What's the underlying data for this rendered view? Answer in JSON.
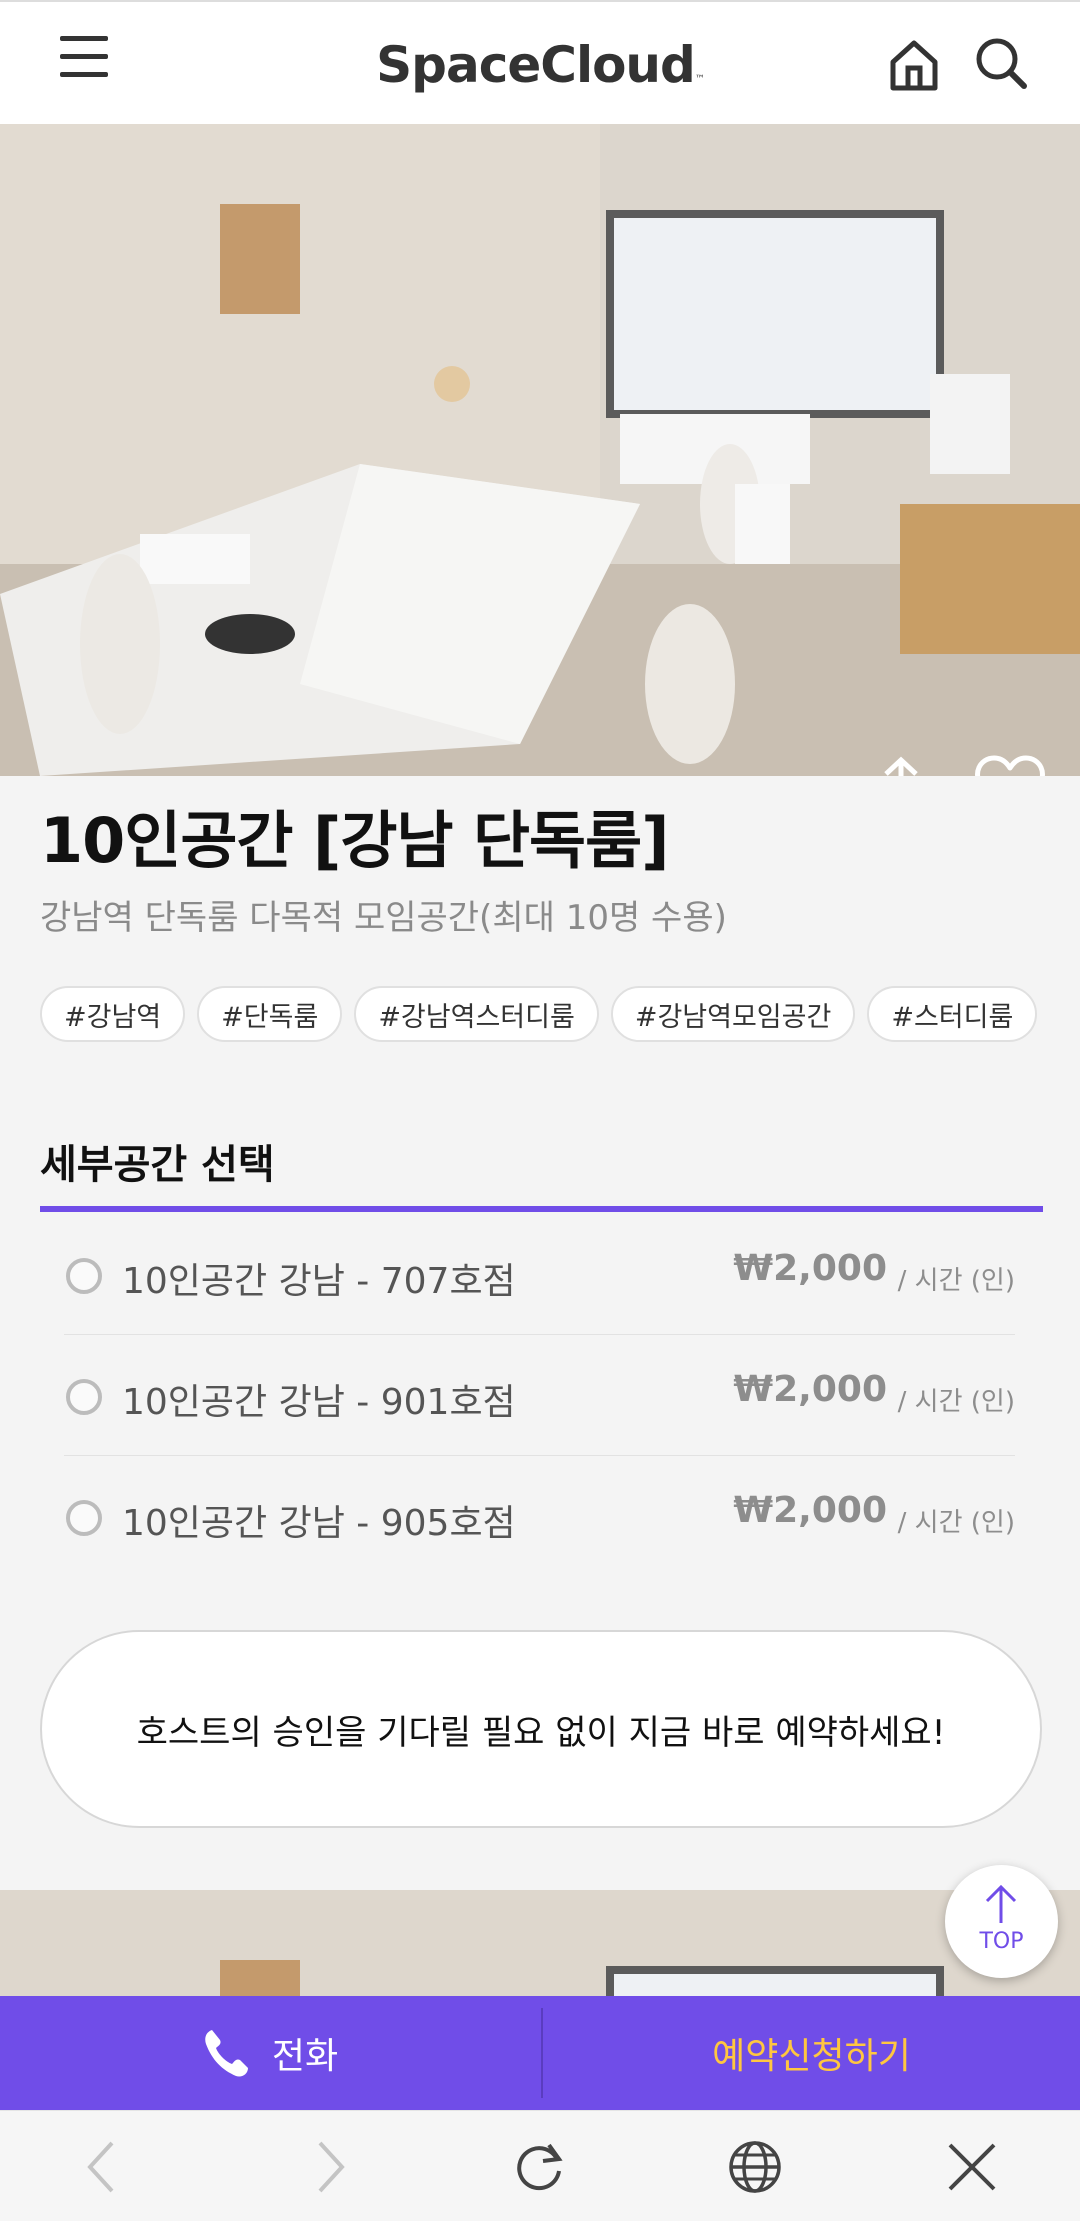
{
  "header": {
    "logo": "SpaceCloud",
    "logo_tm": "™",
    "menu_icon": "hamburger-menu-icon",
    "home_icon": "home-icon",
    "search_icon": "search-icon"
  },
  "hero": {
    "share_icon": "share-icon",
    "heart_icon": "heart-icon"
  },
  "space": {
    "title": "10인공간 [강남 단독룸]",
    "subtitle": "강남역 단독룸 다목적 모임공간(최대 10명 수용)",
    "tags": [
      "#강남역",
      "#단독룸",
      "#강남역스터디룸",
      "#강남역모임공간",
      "#스터디룸"
    ]
  },
  "subspace": {
    "section_title": "세부공간 선택",
    "options": [
      {
        "name": "10인공간 강남 - 707호점",
        "price": "₩2,000",
        "unit": "/ 시간 (인)"
      },
      {
        "name": "10인공간 강남 - 901호점",
        "price": "₩2,000",
        "unit": "/ 시간 (인)"
      },
      {
        "name": "10인공간 강남 - 905호점",
        "price": "₩2,000",
        "unit": "/ 시간 (인)"
      }
    ]
  },
  "notice": "호스트의 승인을 기다릴 필요 없이 지금 바로 예약하세요!",
  "top_button": "TOP",
  "bottom_bar": {
    "call_label": "전화",
    "reserve_label": "예약신청하기"
  },
  "colors": {
    "accent": "#704de8",
    "reserve_text": "#ffc640"
  },
  "browser_nav": [
    "back-icon",
    "forward-icon",
    "reload-icon",
    "globe-icon",
    "close-icon"
  ]
}
